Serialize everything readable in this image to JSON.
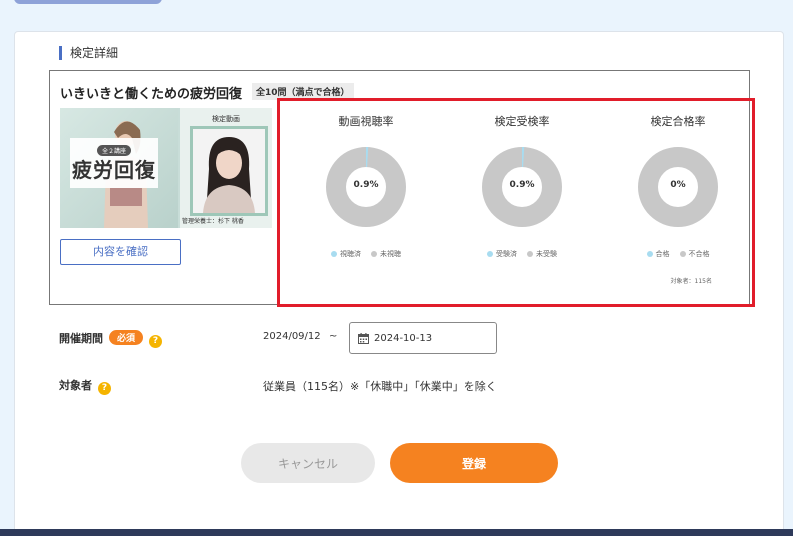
{
  "section_title": "検定詳細",
  "course": {
    "title": "いきいきと働くための疲労回復",
    "question_badge": "全10問（満点で合格）",
    "thumbnail": {
      "banner_sub": "全２講座",
      "banner_main": "疲労回復",
      "video_label": "検定動画",
      "caption": "管理栄養士：杉下 桃香"
    },
    "confirm_button": "内容を確認"
  },
  "stats": {
    "items": [
      {
        "title": "動画視聴率",
        "percent_label": "0.9%",
        "value": 0.9,
        "legend_done": "視聴済",
        "legend_not": "未視聴"
      },
      {
        "title": "検定受検率",
        "percent_label": "0.9%",
        "value": 0.9,
        "legend_done": "受験済",
        "legend_not": "未受験"
      },
      {
        "title": "検定合格率",
        "percent_label": "0%",
        "value": 0,
        "legend_done": "合格",
        "legend_not": "不合格"
      }
    ],
    "target_note": "対象者：115名",
    "colors": {
      "done": "#a8dcf0",
      "not": "#c8c8c8"
    }
  },
  "period": {
    "label": "開催期間",
    "required_badge": "必須",
    "start_date": "2024/09/12",
    "tilde": "~",
    "end_date": "2024-10-13"
  },
  "target": {
    "label": "対象者",
    "value": "従業員（115名）※「休職中」「休業中」を除く"
  },
  "buttons": {
    "cancel": "キャンセル",
    "register": "登録"
  },
  "colors": {
    "accent": "#f58220",
    "link": "#4a6fc4",
    "highlight": "#e11d2a"
  }
}
